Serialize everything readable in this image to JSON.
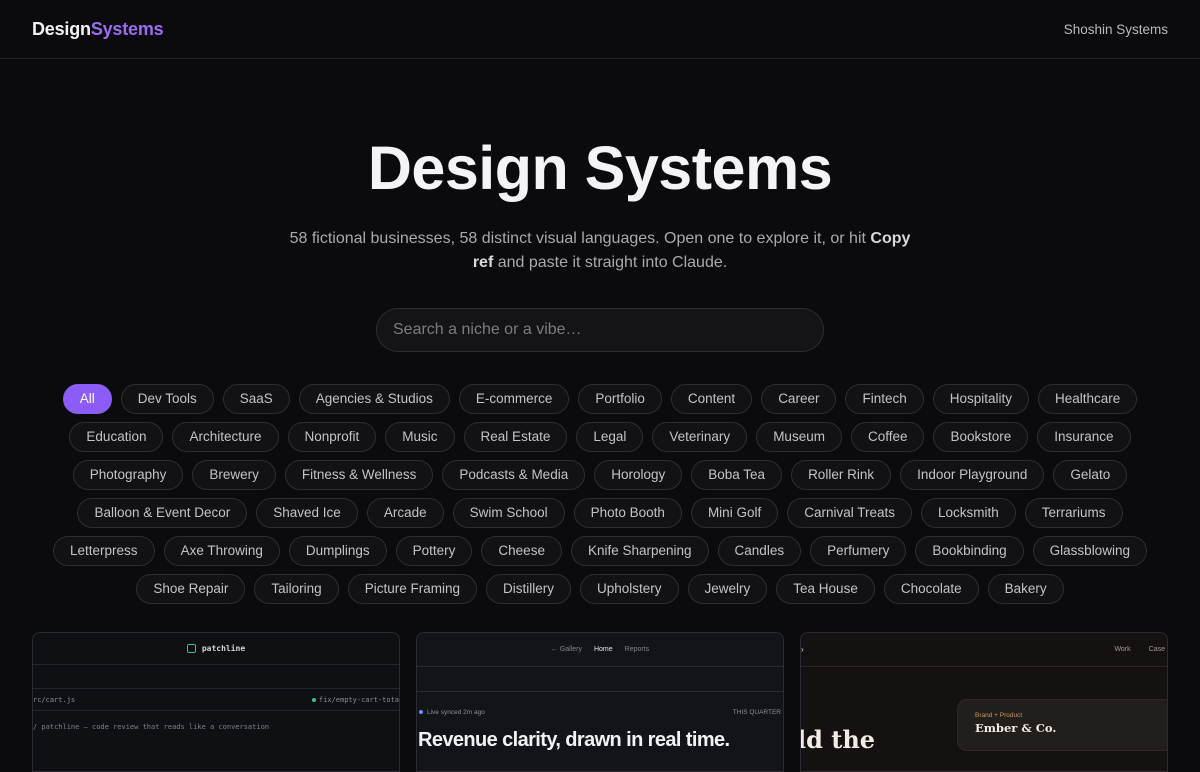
{
  "header": {
    "brand_part1": "Design",
    "brand_part2": "Systems",
    "right_link": "Shoshin Systems"
  },
  "hero": {
    "title": "Design Systems",
    "subtitle_before": "58 fictional businesses, 58 distinct visual languages. Open one to explore it, or hit ",
    "subtitle_bold": "Copy ref",
    "subtitle_after": " and paste it straight into Claude."
  },
  "search": {
    "placeholder": "Search a niche or a vibe…",
    "value": ""
  },
  "filters": {
    "active": "All",
    "items": [
      "All",
      "Dev Tools",
      "SaaS",
      "Agencies & Studios",
      "E-commerce",
      "Portfolio",
      "Content",
      "Career",
      "Fintech",
      "Hospitality",
      "Healthcare",
      "Education",
      "Architecture",
      "Nonprofit",
      "Music",
      "Real Estate",
      "Legal",
      "Veterinary",
      "Museum",
      "Coffee",
      "Bookstore",
      "Insurance",
      "Photography",
      "Brewery",
      "Fitness & Wellness",
      "Podcasts & Media",
      "Horology",
      "Boba Tea",
      "Roller Rink",
      "Indoor Playground",
      "Gelato",
      "Balloon & Event Decor",
      "Shaved Ice",
      "Arcade",
      "Swim School",
      "Photo Booth",
      "Mini Golf",
      "Carnival Treats",
      "Locksmith",
      "Terrariums",
      "Letterpress",
      "Axe Throwing",
      "Dumplings",
      "Pottery",
      "Cheese",
      "Knife Sharpening",
      "Candles",
      "Perfumery",
      "Bookbinding",
      "Glassblowing",
      "Shoe Repair",
      "Tailoring",
      "Picture Framing",
      "Distillery",
      "Upholstery",
      "Jewelry",
      "Tea House",
      "Chocolate",
      "Bakery"
    ]
  },
  "cards": {
    "card1": {
      "name": "patchline",
      "file": "rc/cart.js",
      "branch": "fix/empty-cart-tota",
      "code": "/ patchline — code review that reads like a conversation"
    },
    "card2": {
      "nav_back": "← Gallery",
      "nav_home": "Home",
      "nav_reports": "Reports",
      "live": "Live synced 2m ago",
      "period": "THIS QUARTER",
      "headline": "Revenue clarity, drawn in real time."
    },
    "card3": {
      "mark": "›",
      "nav_work": "Work",
      "nav_case": "Case",
      "panel_small": "Brand + Product",
      "panel_big": "Ember & Co.",
      "serif": "ld the"
    }
  },
  "colors": {
    "accent": "#8b5cf6",
    "brand_highlight": "#9b6cf0",
    "background": "#0b0b0d"
  }
}
